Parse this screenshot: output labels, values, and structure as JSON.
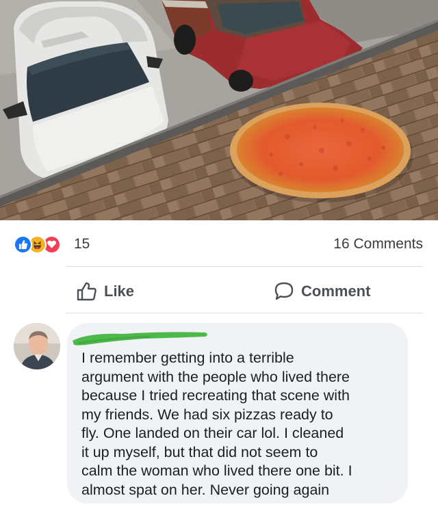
{
  "post": {
    "photo": {
      "icon": "pizza-on-roof-photo"
    },
    "reactions": {
      "icons": [
        "like-icon",
        "haha-icon",
        "love-icon"
      ],
      "count": "15",
      "comments_label": "16 Comments"
    },
    "actions": {
      "like_label": "Like",
      "comment_label": "Comment"
    }
  },
  "comment": {
    "author_redacted": true,
    "text": "I remember getting into a terrible\nargument with the people who lived there\nbecause I tried recreating that scene with\nmy friends. We had six pizzas ready to\nfly. One landed on their car lol. I cleaned\nit up myself, but that did not seem to\ncalm the woman who lived there one bit. I\nalmost spat on her. Never going again"
  },
  "colors": {
    "like_blue": "#1877f2",
    "haha_yellow": "#f7b125",
    "love_red": "#f33e58",
    "bubble_bg": "#f0f2f5",
    "redaction_green": "#4cb94a"
  }
}
